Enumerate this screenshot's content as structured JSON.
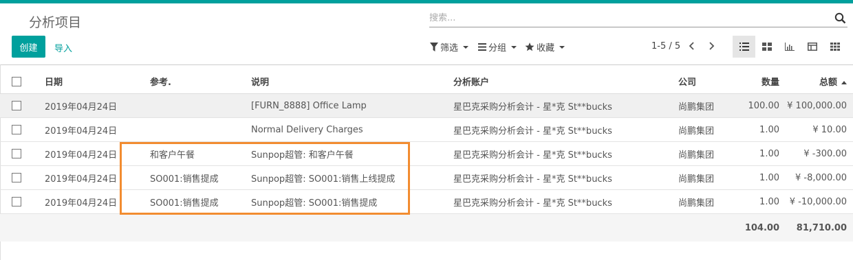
{
  "header": {
    "title": "分析项目",
    "search_placeholder": "搜索..."
  },
  "toolbar": {
    "create_label": "创建",
    "import_label": "导入",
    "filter_label": "筛选",
    "group_label": "分组",
    "favorites_label": "收藏",
    "pager": "1-5 / 5"
  },
  "table": {
    "columns": {
      "date": "日期",
      "ref": "参考.",
      "desc": "说明",
      "account": "分析账户",
      "company": "公司",
      "qty": "数量",
      "amount": "总额"
    },
    "rows": [
      {
        "date": "2019年04月24日",
        "ref": "",
        "desc": "[FURN_8888] Office Lamp",
        "account": "星巴克采购分析会计 - 星*克 St**bucks",
        "company": "尚鹏集团",
        "qty": "100.00",
        "amount": "¥ 100,000.00"
      },
      {
        "date": "2019年04月24日",
        "ref": "",
        "desc": "Normal Delivery Charges",
        "account": "星巴克采购分析会计 - 星*克 St**bucks",
        "company": "尚鹏集团",
        "qty": "1.00",
        "amount": "¥ 10.00"
      },
      {
        "date": "2019年04月24日",
        "ref": "和客户午餐",
        "desc": "Sunpop超管: 和客户午餐",
        "account": "星巴克采购分析会计 - 星*克 St**bucks",
        "company": "尚鹏集团",
        "qty": "1.00",
        "amount": "¥ -300.00"
      },
      {
        "date": "2019年04月24日",
        "ref": "SO001:销售提成",
        "desc": "Sunpop超管: SO001:销售上线提成",
        "account": "星巴克采购分析会计 - 星*克 St**bucks",
        "company": "尚鹏集团",
        "qty": "1.00",
        "amount": "¥ -8,000.00"
      },
      {
        "date": "2019年04月24日",
        "ref": "SO001:销售提成",
        "desc": "Sunpop超管: SO001:销售提成",
        "account": "星巴克采购分析会计 - 星*克 St**bucks",
        "company": "尚鹏集团",
        "qty": "1.00",
        "amount": "¥ -10,000.00"
      }
    ],
    "totals": {
      "qty": "104.00",
      "amount": "81,710.00"
    }
  },
  "colors": {
    "accent": "#00a09d",
    "highlight": "#f28c30"
  }
}
